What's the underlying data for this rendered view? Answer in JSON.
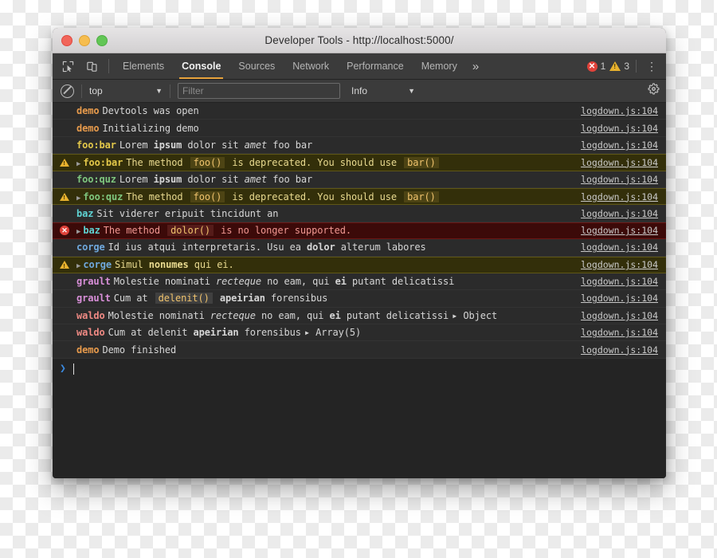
{
  "window": {
    "title": "Developer Tools - http://localhost:5000/",
    "traffic_lights": [
      "close-red",
      "minimize-yellow",
      "maximize-green"
    ]
  },
  "tabbar": {
    "left_icons": [
      {
        "name": "inspect-element-icon",
        "label": "Inspect element"
      },
      {
        "name": "device-toolbar-icon",
        "label": "Toggle device toolbar"
      }
    ],
    "tabs": [
      {
        "label": "Elements",
        "active": false
      },
      {
        "label": "Console",
        "active": true
      },
      {
        "label": "Sources",
        "active": false
      },
      {
        "label": "Network",
        "active": false
      },
      {
        "label": "Performance",
        "active": false
      },
      {
        "label": "Memory",
        "active": false
      }
    ],
    "overflow_label": "»",
    "error_count": "1",
    "warning_count": "3",
    "error_glyph": "✕",
    "warning_glyph": "!",
    "menu_glyph": "⋮",
    "accent_color": "#e8a33d",
    "error_color": "#e0423a",
    "warning_color": "#e8b22e"
  },
  "filterbar": {
    "clear_console_label": "Clear console",
    "context_value": "top",
    "context_caret": "▼",
    "filter_placeholder": "Filter",
    "filter_value": "",
    "level_value": "Info",
    "level_caret": "▼",
    "settings_label": "Settings"
  },
  "console": {
    "source_link": "logdown.js:104",
    "namespace_colors": {
      "demo": "#e89b4c",
      "foo:bar": "#e3c84a",
      "foo:quz": "#7fc77f",
      "baz": "#5fd3d3",
      "corge": "#6fa8dc",
      "grault": "#d98fd9",
      "waldo": "#f08a84"
    },
    "rows": [
      {
        "level": "log",
        "namespace": "demo",
        "ns_color": "#e89b4c",
        "expandable": false,
        "parts": [
          {
            "t": "Devtools was open",
            "s": "plain"
          }
        ],
        "source": "logdown.js:104"
      },
      {
        "level": "log",
        "namespace": "demo",
        "ns_color": "#e89b4c",
        "expandable": false,
        "parts": [
          {
            "t": "Initializing demo",
            "s": "plain"
          }
        ],
        "source": "logdown.js:104"
      },
      {
        "level": "log",
        "namespace": "foo:bar",
        "ns_color": "#e3c84a",
        "expandable": false,
        "parts": [
          {
            "t": "Lorem ",
            "s": "plain"
          },
          {
            "t": "ipsum",
            "s": "bold"
          },
          {
            "t": " dolor sit ",
            "s": "plain"
          },
          {
            "t": "amet",
            "s": "italic"
          },
          {
            "t": " foo bar",
            "s": "plain"
          }
        ],
        "source": "logdown.js:104"
      },
      {
        "level": "warn",
        "namespace": "foo:bar",
        "ns_color": "#e3c84a",
        "expandable": true,
        "parts": [
          {
            "t": "The method ",
            "s": "plain"
          },
          {
            "t": "foo()",
            "s": "code"
          },
          {
            "t": " is deprecated. You should use ",
            "s": "plain"
          },
          {
            "t": "bar()",
            "s": "code"
          }
        ],
        "source": "logdown.js:104"
      },
      {
        "level": "log",
        "namespace": "foo:quz",
        "ns_color": "#7fc77f",
        "expandable": false,
        "parts": [
          {
            "t": "Lorem ",
            "s": "plain"
          },
          {
            "t": "ipsum",
            "s": "bold"
          },
          {
            "t": " dolor sit ",
            "s": "plain"
          },
          {
            "t": "amet",
            "s": "italic"
          },
          {
            "t": " foo bar",
            "s": "plain"
          }
        ],
        "source": "logdown.js:104"
      },
      {
        "level": "warn",
        "namespace": "foo:quz",
        "ns_color": "#7fc77f",
        "expandable": true,
        "parts": [
          {
            "t": "The method ",
            "s": "plain"
          },
          {
            "t": "foo()",
            "s": "code"
          },
          {
            "t": " is deprecated. You should use ",
            "s": "plain"
          },
          {
            "t": "bar()",
            "s": "code"
          }
        ],
        "source": "logdown.js:104"
      },
      {
        "level": "log",
        "namespace": "baz",
        "ns_color": "#5fd3d3",
        "expandable": false,
        "parts": [
          {
            "t": "Sit viderer eripuit tincidunt an",
            "s": "plain"
          }
        ],
        "source": "logdown.js:104"
      },
      {
        "level": "error",
        "namespace": "baz",
        "ns_color": "#5fd3d3",
        "expandable": true,
        "parts": [
          {
            "t": "The method ",
            "s": "plain"
          },
          {
            "t": "dolor()",
            "s": "code"
          },
          {
            "t": " is no longer supported.",
            "s": "plain"
          }
        ],
        "source": "logdown.js:104"
      },
      {
        "level": "log",
        "namespace": "corge",
        "ns_color": "#6fa8dc",
        "expandable": false,
        "parts": [
          {
            "t": "Id ius atqui interpretaris. Usu ea ",
            "s": "plain"
          },
          {
            "t": "dolor",
            "s": "bold"
          },
          {
            "t": " alterum labores",
            "s": "plain"
          }
        ],
        "source": "logdown.js:104"
      },
      {
        "level": "warn",
        "namespace": "corge",
        "ns_color": "#6fa8dc",
        "expandable": true,
        "parts": [
          {
            "t": "Simul ",
            "s": "plain"
          },
          {
            "t": "nonumes",
            "s": "bold"
          },
          {
            "t": " qui ei.",
            "s": "plain"
          }
        ],
        "source": "logdown.js:104"
      },
      {
        "level": "log",
        "namespace": "grault",
        "ns_color": "#d98fd9",
        "expandable": false,
        "parts": [
          {
            "t": "Molestie nominati ",
            "s": "plain"
          },
          {
            "t": "recteque",
            "s": "italic"
          },
          {
            "t": " no eam, qui ",
            "s": "plain"
          },
          {
            "t": "ei",
            "s": "bold"
          },
          {
            "t": " putant delicatissi",
            "s": "plain"
          }
        ],
        "source": "logdown.js:104"
      },
      {
        "level": "log",
        "namespace": "grault",
        "ns_color": "#d98fd9",
        "expandable": false,
        "parts": [
          {
            "t": "Cum at ",
            "s": "plain"
          },
          {
            "t": "delenit()",
            "s": "code"
          },
          {
            "t": " ",
            "s": "plain"
          },
          {
            "t": "apeirian",
            "s": "bold"
          },
          {
            "t": " forensibus",
            "s": "plain"
          }
        ],
        "source": "logdown.js:104"
      },
      {
        "level": "log",
        "namespace": "waldo",
        "ns_color": "#f08a84",
        "expandable": false,
        "parts": [
          {
            "t": "Molestie nominati ",
            "s": "plain"
          },
          {
            "t": "recteque",
            "s": "italic"
          },
          {
            "t": " no eam, qui ",
            "s": "plain"
          },
          {
            "t": "ei",
            "s": "bold"
          },
          {
            "t": " putant delicatissi",
            "s": "plain"
          },
          {
            "t": "▸ Object",
            "s": "objref"
          }
        ],
        "source": "logdown.js:104"
      },
      {
        "level": "log",
        "namespace": "waldo",
        "ns_color": "#f08a84",
        "expandable": false,
        "parts": [
          {
            "t": "Cum at delenit ",
            "s": "plain"
          },
          {
            "t": "apeirian",
            "s": "bold"
          },
          {
            "t": " forensibus",
            "s": "plain"
          },
          {
            "t": "▸ Array(5)",
            "s": "objref"
          }
        ],
        "source": "logdown.js:104"
      },
      {
        "level": "log",
        "namespace": "demo",
        "ns_color": "#e89b4c",
        "expandable": false,
        "parts": [
          {
            "t": "Demo finished",
            "s": "plain"
          }
        ],
        "source": "logdown.js:104"
      }
    ],
    "prompt": {
      "arrow": "❯",
      "value": ""
    }
  }
}
